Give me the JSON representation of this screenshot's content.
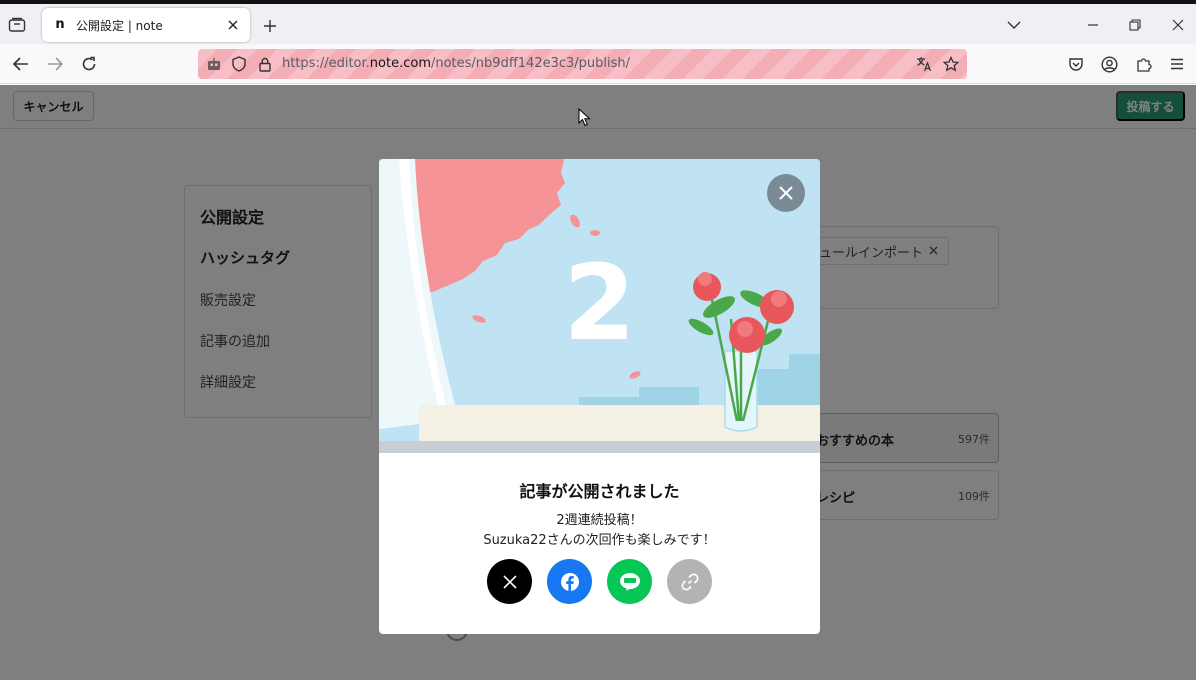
{
  "browser": {
    "tab": {
      "favicon": "n",
      "title": "公開設定 | note"
    },
    "url": {
      "prefix": "https://editor.",
      "domain": "note.com",
      "path": "/notes/nb9dff142e3c3/publish/"
    }
  },
  "header": {
    "cancel_label": "キャンセル",
    "post_label": "投稿する"
  },
  "sidebar": {
    "title": "公開設定",
    "items": [
      {
        "label": "ハッシュタグ"
      },
      {
        "label": "販売設定"
      },
      {
        "label": "記事の追加"
      },
      {
        "label": "詳細設定"
      }
    ]
  },
  "hashtags": {
    "chip_label": "ュールインポート"
  },
  "magazines": [
    {
      "name": "おすすめの本",
      "count": "597件"
    },
    {
      "name": "レシピ",
      "count": "109件"
    }
  ],
  "modal": {
    "streak_number": "2",
    "title": "記事が公開されました",
    "message_line1": "2週連続投稿！",
    "message_line2": "Suzuka22さんの次回作も楽しみです！",
    "share_buttons": [
      {
        "icon": "x-icon",
        "color": "#000000"
      },
      {
        "icon": "facebook-icon",
        "color": "#1877f2"
      },
      {
        "icon": "line-icon",
        "color": "#06c755"
      },
      {
        "icon": "link-icon",
        "color": "#b3b3b3"
      }
    ]
  },
  "colors": {
    "accent": "#2a9d7a",
    "overlay": "rgba(0,0,0,0.5)"
  }
}
